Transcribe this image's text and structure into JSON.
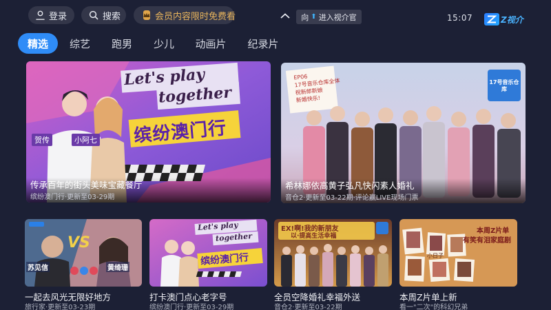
{
  "header": {
    "login_label": "登录",
    "search_label": "搜索",
    "vip_label": "会员内容限时免费看",
    "enter_view_prefix": "向",
    "enter_view_label": "进入视介官",
    "time": "15:07",
    "logo_text": "Z视介"
  },
  "tabs": [
    {
      "label": "精选",
      "active": true
    },
    {
      "label": "综艺",
      "active": false
    },
    {
      "label": "跑男",
      "active": false
    },
    {
      "label": "少儿",
      "active": false
    },
    {
      "label": "动画片",
      "active": false
    },
    {
      "label": "纪录片",
      "active": false
    }
  ],
  "featured": [
    {
      "title": "传承百年的街头美味宝藏餐厅",
      "subtitle": "缤纷澳门行·更新至03-29期",
      "poster": {
        "headline_1": "Let's play",
        "headline_2": "together",
        "show_name": "缤纷澳门行",
        "tag_left": "贺传",
        "tag_right": "小阿七"
      }
    },
    {
      "title": "希林娜依高黄子弘凡快闪素人婚礼",
      "subtitle": "音仓2·更新至03-22期·评论赢LIVE现场门票",
      "poster": {
        "episode": "EP06",
        "note_line_1": "17号音乐仓库全体",
        "note_line_2": "祝新郎新娘",
        "note_line_3": "新婚快乐!",
        "brand": "17号音乐仓库"
      }
    }
  ],
  "row": [
    {
      "title": "一起去风光无限好地方",
      "subtitle": "旅行家·更新至03-23期",
      "poster": {
        "vs": "VS",
        "name_left": "苏见信",
        "name_right": "黄绮珊"
      }
    },
    {
      "title": "打卡澳门点心老字号",
      "subtitle": "缤纷澳门行·更新至03-29期",
      "poster": {
        "headline_1": "Let's play",
        "headline_2": "together",
        "show_name": "缤纷澳门行"
      }
    },
    {
      "title": "全员空降婚礼幸福外送",
      "subtitle": "音仓2·更新至03-22期",
      "poster": {
        "banner": "EX!啊!我的新朋友",
        "banner_2": "以·提高生活幸福"
      }
    },
    {
      "title": "本周Z片单上新",
      "subtitle": "看一\"二次\"的科幻兄弟",
      "poster": {
        "line_1": "本周Z片单",
        "line_2": "有笑有泪家庭剧",
        "line_3": "小日子"
      }
    }
  ],
  "colors": {
    "background": "#1c2035",
    "tab_active": "#2f8cf7",
    "vip_gold": "#e2a64a",
    "accent_blue": "#3fb6ff"
  }
}
